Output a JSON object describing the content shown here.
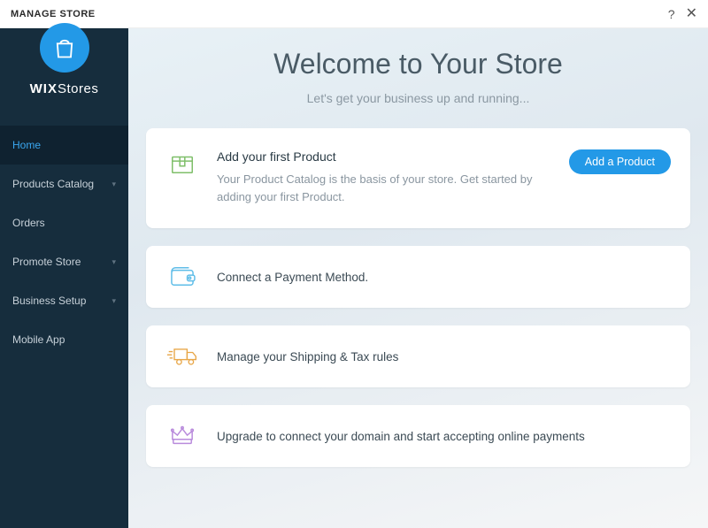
{
  "header": {
    "title": "MANAGE STORE",
    "help_icon": "help-icon",
    "close_icon": "close-icon"
  },
  "brand": {
    "name_bold": "WIX",
    "name_thin": "Stores",
    "logo_icon": "shopping-bag-icon"
  },
  "sidebar": {
    "items": [
      {
        "label": "Home",
        "active": true,
        "expandable": false
      },
      {
        "label": "Products Catalog",
        "active": false,
        "expandable": true
      },
      {
        "label": "Orders",
        "active": false,
        "expandable": false
      },
      {
        "label": "Promote Store",
        "active": false,
        "expandable": true
      },
      {
        "label": "Business Setup",
        "active": false,
        "expandable": true
      },
      {
        "label": "Mobile App",
        "active": false,
        "expandable": false
      }
    ]
  },
  "main": {
    "title": "Welcome to Your Store",
    "subtitle": "Let's get your business up and running...",
    "cards": [
      {
        "icon": "box-icon",
        "title": "Add your first Product",
        "desc": "Your Product Catalog is the basis of your store. Get started by adding your first Product.",
        "button": "Add a Product"
      },
      {
        "icon": "wallet-icon",
        "text": "Connect a Payment Method."
      },
      {
        "icon": "truck-icon",
        "text": "Manage your Shipping & Tax rules"
      },
      {
        "icon": "crown-icon",
        "text": "Upgrade to connect your domain and start accepting online payments"
      }
    ]
  },
  "colors": {
    "accent": "#2399e7",
    "sidebar_bg": "#162d3d"
  }
}
